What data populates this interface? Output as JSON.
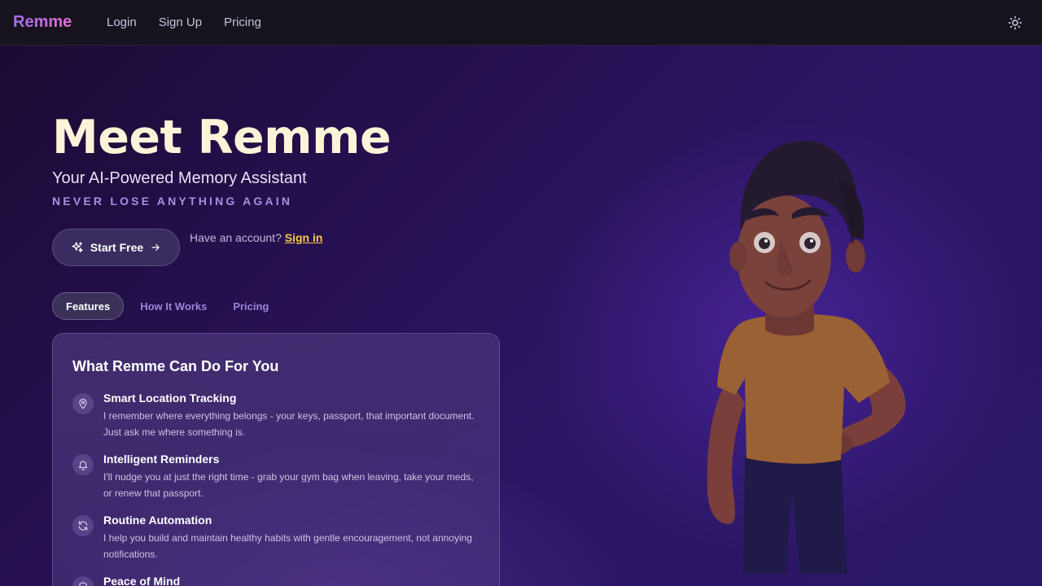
{
  "nav": {
    "brand": "Remme",
    "links": [
      "Login",
      "Sign Up",
      "Pricing"
    ],
    "theme_icon": "sun-icon"
  },
  "hero": {
    "title": "Meet Remme",
    "subtitle": "Your AI-Powered Memory Assistant",
    "tagline": "NEVER LOSE ANYTHING AGAIN",
    "cta_label": "Start Free",
    "account_prompt": "Have an account?",
    "signin_label": "Sign in"
  },
  "tabs": [
    {
      "label": "Features",
      "active": true
    },
    {
      "label": "How It Works",
      "active": false
    },
    {
      "label": "Pricing",
      "active": false
    }
  ],
  "card": {
    "title": "What Remme Can Do For You",
    "features": [
      {
        "icon": "location-pin-icon",
        "title": "Smart Location Tracking",
        "desc": "I remember where everything belongs - your keys, passport, that important document. Just ask me where something is."
      },
      {
        "icon": "bell-icon",
        "title": "Intelligent Reminders",
        "desc": "I'll nudge you at just the right time - grab your gym bag when leaving, take your meds, or renew that passport."
      },
      {
        "icon": "refresh-icon",
        "title": "Routine Automation",
        "desc": "I help you build and maintain healthy habits with gentle encouragement, not annoying notifications."
      },
      {
        "icon": "shield-icon",
        "title": "Peace of Mind",
        "desc": ""
      }
    ]
  },
  "colors": {
    "accent_gold": "#f7c948",
    "title_cream": "#fdf3d8",
    "tagline_purple": "#a58fe0"
  }
}
